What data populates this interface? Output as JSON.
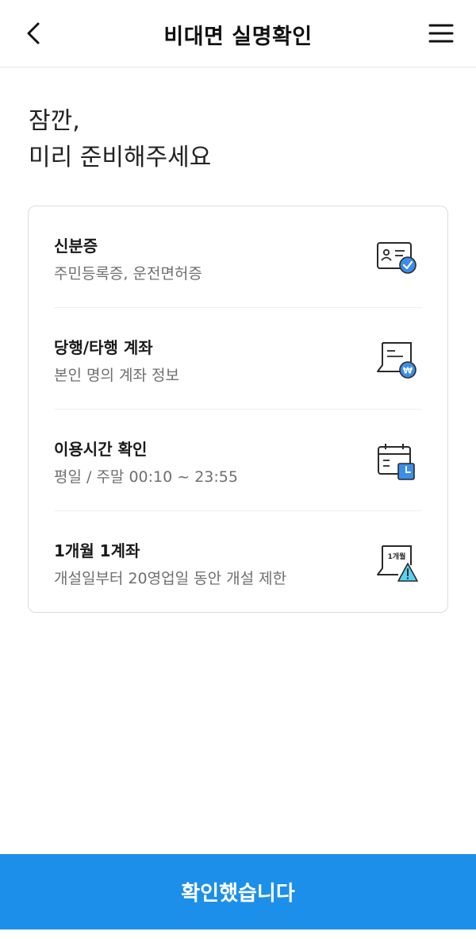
{
  "header": {
    "title": "비대면 실명확인",
    "back_icon": "chevron-left-icon",
    "menu_icon": "hamburger-menu-icon"
  },
  "headline": {
    "line1": "잠깐,",
    "line2": "미리 준비해주세요"
  },
  "checklist": {
    "items": [
      {
        "title": "신분증",
        "subtitle": "주민등록증, 운전면허증",
        "icon": "id-card-check-icon"
      },
      {
        "title": "당행/타행 계좌",
        "subtitle": "본인 명의 계좌 정보",
        "icon": "bank-account-won-icon"
      },
      {
        "title": "이용시간 확인",
        "subtitle": "평일 / 주말 00:10 ~ 23:55",
        "icon": "calendar-clock-icon"
      },
      {
        "title": "1개월 1계좌",
        "subtitle": "개설일부터 20영업일 동안 개설 제한",
        "icon": "document-warning-icon",
        "icon_text": "1개월"
      }
    ]
  },
  "footer": {
    "confirm_label": "확인했습니다"
  },
  "colors": {
    "accent": "#1c8fea",
    "icon_blue": "#3b8ee8",
    "icon_line": "#2a2a2a"
  }
}
